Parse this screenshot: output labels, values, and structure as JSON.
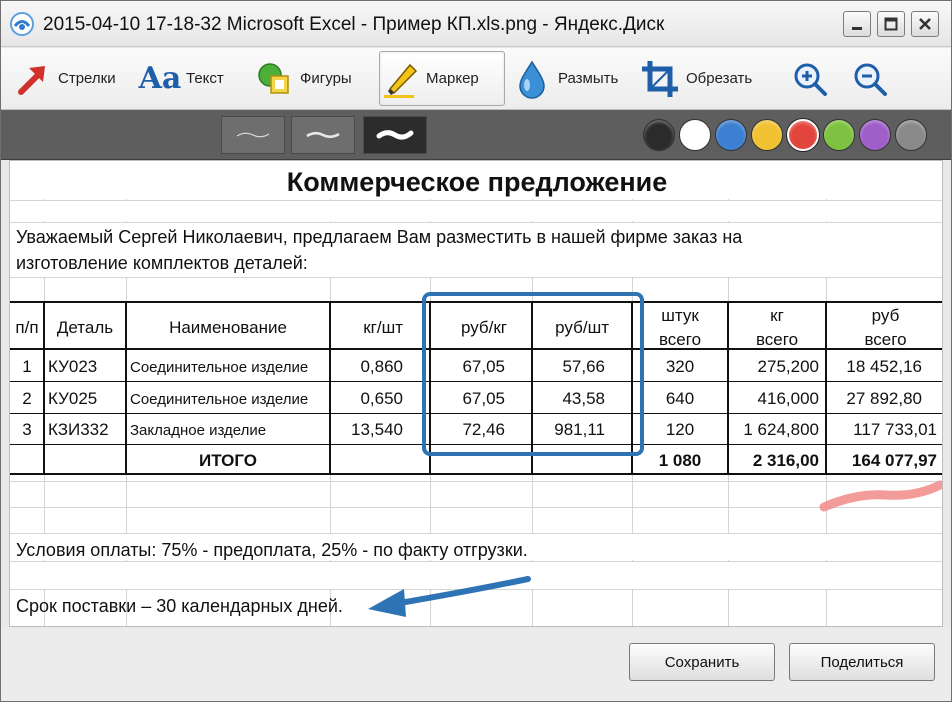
{
  "window": {
    "title": "2015-04-10 17-18-32 Microsoft Excel - Пример КП.xls.png - Яндекс.Диск"
  },
  "toolbar": {
    "tools": [
      {
        "id": "arrows",
        "label": "Стрелки",
        "icon": "arrow-icon"
      },
      {
        "id": "text",
        "label": "Текст",
        "icon": "text-icon",
        "glyph": "Aa"
      },
      {
        "id": "shapes",
        "label": "Фигуры",
        "icon": "shapes-icon"
      },
      {
        "id": "marker",
        "label": "Маркер",
        "icon": "marker-icon",
        "active": true
      },
      {
        "id": "blur",
        "label": "Размыть",
        "icon": "blur-drop-icon"
      },
      {
        "id": "crop",
        "label": "Обрезать",
        "icon": "crop-icon"
      }
    ],
    "zoom_in_icon": "zoom-in-icon",
    "zoom_out_icon": "zoom-out-icon"
  },
  "stroke_widths": [
    "thin",
    "medium",
    "thick"
  ],
  "colors": {
    "swatches": [
      "#2b2b2b",
      "#ffffff",
      "#3d7fd1",
      "#f1c232",
      "#e2453c",
      "#7fc241",
      "#9e5fc9",
      "#8a8a8a"
    ],
    "selected": "#e2453c",
    "annotation_blue": "#2e74b5",
    "marker_red": "#f08a86"
  },
  "sheet": {
    "title": "Коммерческое предложение",
    "intro_line1": "Уважаемый Сергей Николаевич, предлагаем Вам разместить в нашей фирме заказ на",
    "intro_line2": "изготовление комплектов деталей:",
    "headers": {
      "num": "п/п",
      "part": "Деталь",
      "name": "Наименование",
      "kg_per_pc": "кг/шт",
      "rub_per_kg": "руб/кг",
      "rub_per_pc": "руб/шт",
      "pcs_total_1": "штук",
      "pcs_total_2": "всего",
      "kg_total_1": "кг",
      "kg_total_2": "всего",
      "rub_total_1": "руб",
      "rub_total_2": "всего"
    },
    "rows": [
      {
        "num": "1",
        "part": "КУ023",
        "name": "Соединительное изделие",
        "kg_per_pc": "0,860",
        "rub_per_kg": "67,05",
        "rub_per_pc": "57,66",
        "pcs": "320",
        "kg": "275,200",
        "rub": "18 452,16"
      },
      {
        "num": "2",
        "part": "КУ025",
        "name": "Соединительное изделие",
        "kg_per_pc": "0,650",
        "rub_per_kg": "67,05",
        "rub_per_pc": "43,58",
        "pcs": "640",
        "kg": "416,000",
        "rub": "27 892,80"
      },
      {
        "num": "3",
        "part": "КЗИ332",
        "name": "Закладное изделие",
        "kg_per_pc": "13,540",
        "rub_per_kg": "72,46",
        "rub_per_pc": "981,11",
        "pcs": "120",
        "kg": "1 624,800",
        "rub": "117 733,01"
      }
    ],
    "total": {
      "label": "ИТОГО",
      "pcs": "1 080",
      "kg": "2 316,00",
      "rub": "164 077,97"
    },
    "payment_terms": "Условия оплаты: 75% - предоплата, 25% - по факту отгрузки.",
    "delivery_terms": "Срок поставки – 30 календарных дней."
  },
  "footer": {
    "save_label": "Сохранить",
    "share_label": "Поделиться"
  }
}
